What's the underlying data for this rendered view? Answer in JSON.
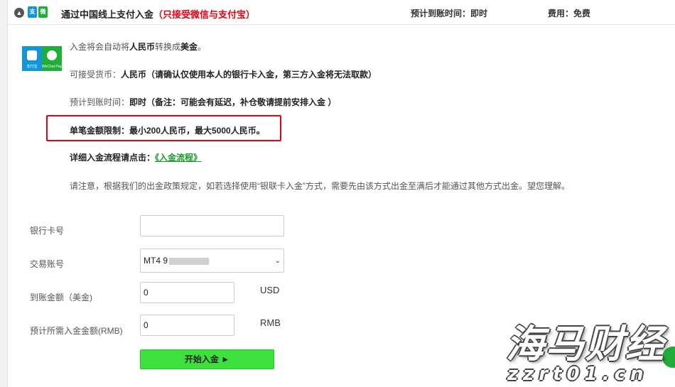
{
  "header": {
    "title": "通过中国线上支付入金",
    "title_warning": "（只接受微信与支付宝）",
    "arrival_label": "预计到账时间：即时",
    "fee_label": "费用：免费"
  },
  "logos": {
    "alipay_caption": "支付宝",
    "wechat_caption": "WeChat Pay"
  },
  "info": {
    "line1_prefix": "入金将会自动将",
    "line1_from": "人民币",
    "line1_mid": "转换成",
    "line1_to": "美金",
    "line1_end": "。",
    "line2_prefix": "可接受货币：",
    "line2_value": "人民币（请确认仅使用本人的银行卡入金，第三方入金将无法取款）",
    "line3_prefix": "预计到账时间：",
    "line3_value": "即时（备注：可能会有延迟，补仓敬请提前安排入金 ）",
    "line4": "单笔金额限制：最小200人民币，最大5000人民币。",
    "line5_prefix": "详细入金流程请点击：",
    "line5_link": "《入金流程》",
    "line6": "请注意，根据我们的出金政策规定，如若选择使用“银联卡入金”方式，需要先由该方式出金至满后才能通过其他方式出金。望您理解。"
  },
  "form": {
    "card_label": "银行卡号",
    "card_value": "",
    "account_label": "交易账号",
    "account_value": "MT4 9",
    "usd_label": "到账金额（美金)",
    "usd_value": "0",
    "usd_unit": "USD",
    "rmb_label": "预计所需入金金额(RMB)",
    "rmb_value": "0",
    "rmb_unit": "RMB",
    "submit_label": "开始入金 ►"
  },
  "watermark": {
    "main": "海马财经",
    "url": "zzrt01.cn"
  },
  "colors": {
    "accent_green": "#3ee03e",
    "warning_red": "#e60012",
    "link_green": "#1a9a2a",
    "alipay_blue": "#1296db",
    "wechat_green": "#22ac38"
  }
}
